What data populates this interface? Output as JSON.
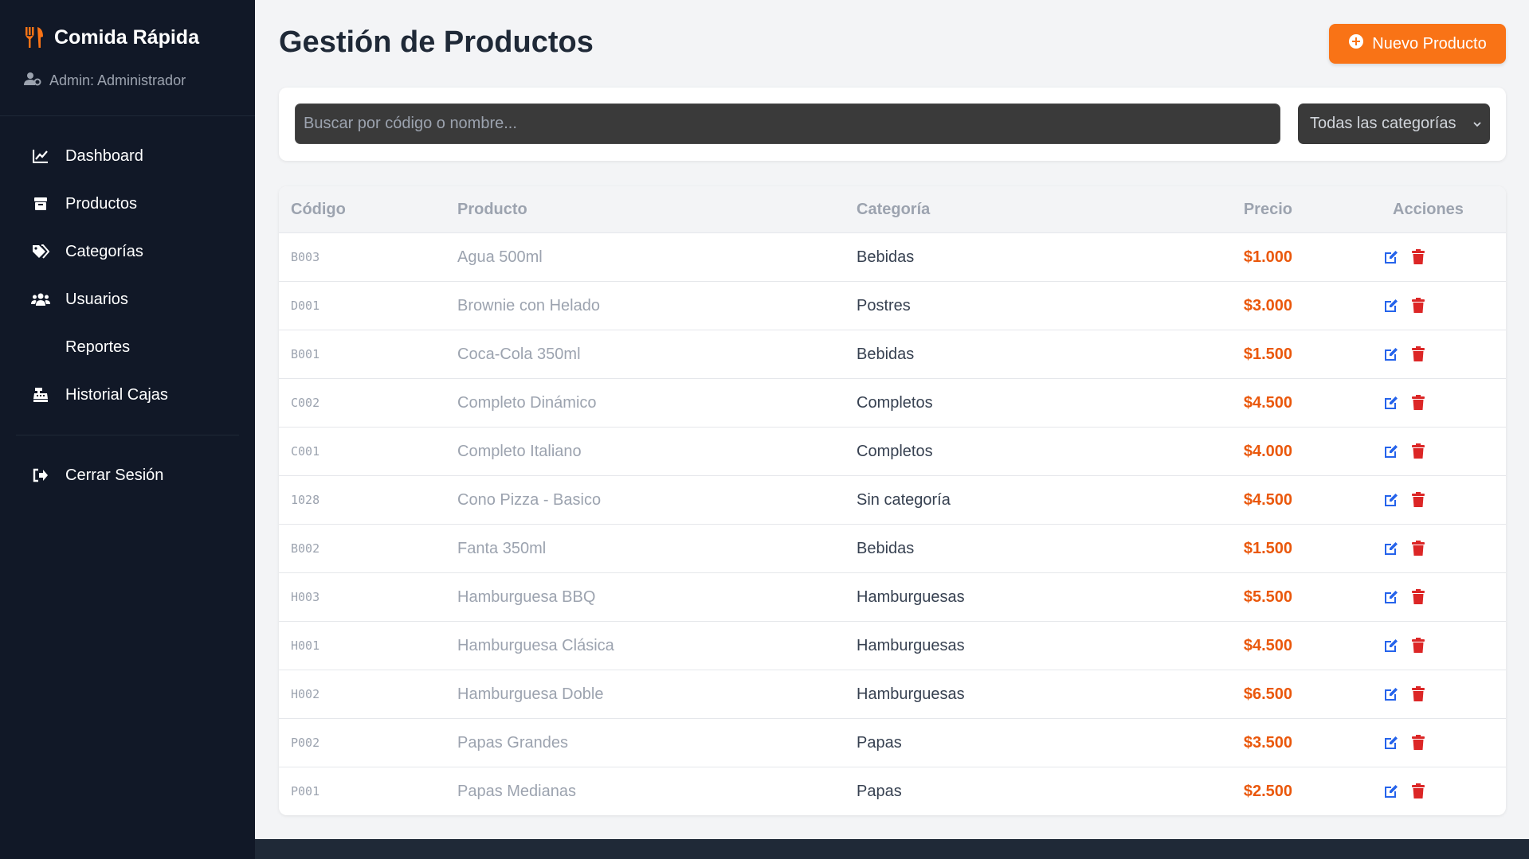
{
  "brand": {
    "name": "Comida Rápida",
    "accent": "#f97316"
  },
  "admin": {
    "label": "Admin: Administrador"
  },
  "nav": [
    {
      "label": "Dashboard",
      "icon": "chart-line-icon"
    },
    {
      "label": "Productos",
      "icon": "box-icon"
    },
    {
      "label": "Categorías",
      "icon": "tags-icon"
    },
    {
      "label": "Usuarios",
      "icon": "users-icon"
    },
    {
      "label": "Reportes",
      "icon": ""
    },
    {
      "label": "Historial Cajas",
      "icon": "cash-register-icon"
    }
  ],
  "logout": {
    "label": "Cerrar Sesión",
    "icon": "sign-out-icon"
  },
  "page": {
    "title": "Gestión de Productos",
    "new_button": "Nuevo Producto"
  },
  "filters": {
    "search_placeholder": "Buscar por código o nombre...",
    "category_selected": "Todas las categorías"
  },
  "table": {
    "headers": {
      "code": "Código",
      "product": "Producto",
      "category": "Categoría",
      "price": "Precio",
      "actions": "Acciones"
    },
    "rows": [
      {
        "code": "B003",
        "product": "Agua 500ml",
        "category": "Bebidas",
        "price": "$1.000"
      },
      {
        "code": "D001",
        "product": "Brownie con Helado",
        "category": "Postres",
        "price": "$3.000"
      },
      {
        "code": "B001",
        "product": "Coca-Cola 350ml",
        "category": "Bebidas",
        "price": "$1.500"
      },
      {
        "code": "C002",
        "product": "Completo Dinámico",
        "category": "Completos",
        "price": "$4.500"
      },
      {
        "code": "C001",
        "product": "Completo Italiano",
        "category": "Completos",
        "price": "$4.000"
      },
      {
        "code": "1028",
        "product": "Cono Pizza - Basico",
        "category": "Sin categoría",
        "price": "$4.500"
      },
      {
        "code": "B002",
        "product": "Fanta 350ml",
        "category": "Bebidas",
        "price": "$1.500"
      },
      {
        "code": "H003",
        "product": "Hamburguesa BBQ",
        "category": "Hamburguesas",
        "price": "$5.500"
      },
      {
        "code": "H001",
        "product": "Hamburguesa Clásica",
        "category": "Hamburguesas",
        "price": "$4.500"
      },
      {
        "code": "H002",
        "product": "Hamburguesa Doble",
        "category": "Hamburguesas",
        "price": "$6.500"
      },
      {
        "code": "P002",
        "product": "Papas Grandes",
        "category": "Papas",
        "price": "$3.500"
      },
      {
        "code": "P001",
        "product": "Papas Medianas",
        "category": "Papas",
        "price": "$2.500"
      }
    ]
  },
  "colors": {
    "sidebar": "#111827",
    "price": "#ea580c",
    "edit": "#2563eb",
    "delete": "#dc2626"
  }
}
